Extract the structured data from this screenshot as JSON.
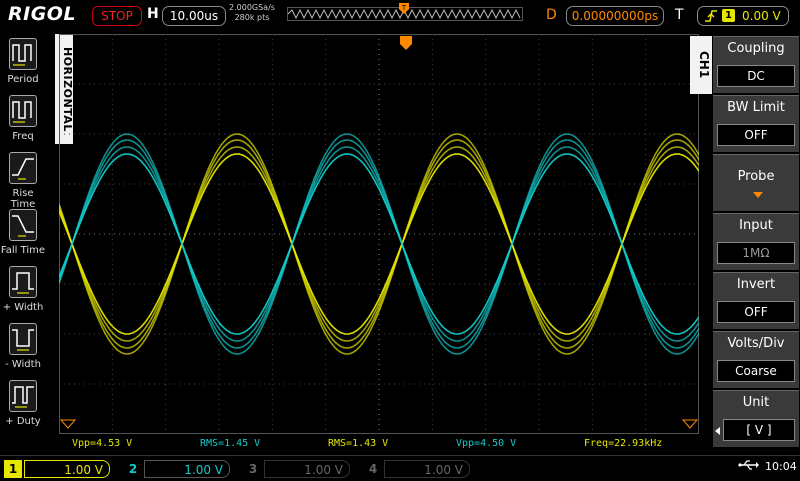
{
  "top": {
    "logo": "RIGOL",
    "run_state": "STOP",
    "h_label": "H",
    "timebase": "10.00us",
    "sample_rate": "2.000GSa/s",
    "mem_depth": "280k pts",
    "d_label": "D",
    "delay": "0.00000000ps",
    "t_label": "T",
    "trigger_channel": "1",
    "trigger_level": "0.00 V"
  },
  "left_menu": {
    "title": "HORIZONTAL",
    "items": [
      {
        "label": "Period"
      },
      {
        "label": "Freq"
      },
      {
        "label": "Rise Time"
      },
      {
        "label": "Fall Time"
      },
      {
        "label": "+ Width"
      },
      {
        "label": "- Width"
      },
      {
        "label": "+ Duty"
      }
    ]
  },
  "right_menu": {
    "title": "CH1",
    "items": [
      {
        "title": "Coupling",
        "value": "DC"
      },
      {
        "title": "BW Limit",
        "value": "OFF"
      },
      {
        "title": "Probe",
        "value": ""
      },
      {
        "title": "Input",
        "value": "1MΩ"
      },
      {
        "title": "Invert",
        "value": "OFF"
      },
      {
        "title": "Volts/Div",
        "value": "Coarse"
      },
      {
        "title": "Unit",
        "value": "[ V ]"
      }
    ]
  },
  "measurements": [
    {
      "text": "Vpp=4.53 V",
      "channel": 1
    },
    {
      "text": "RMS=1.45 V",
      "channel": 2
    },
    {
      "text": "RMS=1.43 V",
      "channel": 1
    },
    {
      "text": "Vpp=4.50 V",
      "channel": 2
    },
    {
      "text": "Freq=22.93kHz",
      "channel": 1
    }
  ],
  "channels": [
    {
      "num": "1",
      "scale": "1.00 V",
      "color": "#e6e600",
      "active": true
    },
    {
      "num": "2",
      "scale": "1.00 V",
      "color": "#1cc",
      "active": true
    },
    {
      "num": "3",
      "scale": "1.00 V",
      "color": "#666",
      "active": false
    },
    {
      "num": "4",
      "scale": "1.00 V",
      "color": "#666",
      "active": false
    }
  ],
  "status": {
    "time": "10:04"
  },
  "colors": {
    "ch1": "#e6e600",
    "ch2": "#1cc",
    "accent": "#ff8800",
    "stop": "#e22"
  }
}
